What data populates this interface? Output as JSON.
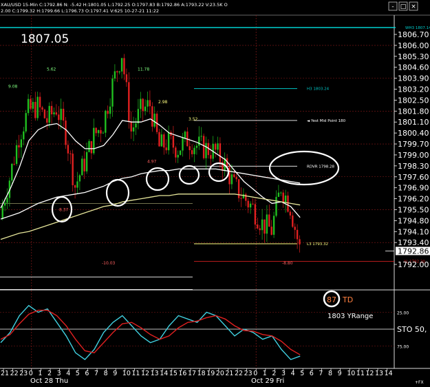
{
  "header": {
    "symbol_line": "XAU/USD  15-Min  C:1792.86  N: -5.42  H:1801.05  L:1792.25  O:1797.83  B:1792.86  A:1793.22  V:23.5K  O",
    "sub_line": "2.00  C:1799.32  H:1799.66  L:1796.73  O:1797.41  V:625  10-27-21  11:22",
    "window_buttons": [
      "-",
      "□",
      "×"
    ]
  },
  "big_price": "1807.05",
  "price_axis": {
    "ticks": [
      "1806.70",
      "1806.00",
      "1805.30",
      "1804.60",
      "1803.90",
      "1803.20",
      "1802.50",
      "1801.80",
      "1801.10",
      "1800.40",
      "1799.70",
      "1799.00",
      "1798.30",
      "1797.60",
      "1796.90",
      "1796.20",
      "1795.50",
      "1794.80",
      "1794.10",
      "1793.40",
      "1792.00"
    ],
    "tick_values": [
      1806.7,
      1806.0,
      1805.3,
      1804.6,
      1803.9,
      1803.2,
      1802.5,
      1801.8,
      1801.1,
      1800.4,
      1799.7,
      1799.0,
      1798.3,
      1797.6,
      1796.9,
      1796.2,
      1795.5,
      1794.8,
      1794.1,
      1793.4,
      1792.0
    ],
    "current_price": "1792.86",
    "current_value": 1792.86
  },
  "levels": [
    {
      "label": "WH3 1807.14",
      "value": 1807.14,
      "color": "#00d0d0"
    },
    {
      "label": "H3 1803.24",
      "value": 1803.24,
      "color": "#00c8c8"
    },
    {
      "label": "◄ Yest Mid Point 180",
      "value": 1801.2,
      "color": "#ffffff"
    },
    {
      "label": "RDVR 1798.28",
      "value": 1798.28,
      "color": "#ffffff"
    },
    {
      "label": "L3 1793.32",
      "value": 1793.32,
      "color": "#ffff80"
    },
    {
      "label": "YL 1792.20",
      "value": 1792.2,
      "color": "#d02020"
    }
  ],
  "annotations": [
    {
      "text": "9.08",
      "value": 1803.3,
      "color": "#80ff80"
    },
    {
      "text": "5.62",
      "value": 1804.4,
      "color": "#80ff80"
    },
    {
      "text": "11.78",
      "value": 1804.4,
      "color": "#80ff80"
    },
    {
      "text": "2.98",
      "value": 1802.3,
      "color": "#ffff80"
    },
    {
      "text": "3.52",
      "value": 1801.2,
      "color": "#ffff80"
    },
    {
      "text": "8.37",
      "value": 1795.4,
      "color": "#ff6060"
    },
    {
      "text": "4.97",
      "value": 1798.5,
      "color": "#ff6060"
    },
    {
      "text": "-10.03",
      "value": 1792.0,
      "color": "#ff6060"
    },
    {
      "text": "-8.80",
      "value": 1792.0,
      "color": "#ff6060"
    }
  ],
  "oscillator": {
    "name": "STO",
    "label": "STO  50,",
    "ticks": [
      "25.00",
      "75.00"
    ],
    "tick_values": [
      25,
      75
    ],
    "td_label": "87 TD",
    "td_number": "87",
    "yrange_label": "1803 YRange"
  },
  "time_axis": {
    "labels": [
      "21",
      "22",
      "23",
      "0",
      "1",
      "2",
      "3",
      "4",
      "5",
      "6",
      "7",
      "8",
      "9",
      "10",
      "11",
      "12",
      "13",
      "14",
      "15",
      "16",
      "17",
      "18",
      "19",
      "20",
      "21",
      "22",
      "23",
      "0",
      "1",
      "2",
      "3",
      "4",
      "5",
      "6",
      "7",
      "8",
      "9",
      "10",
      "11",
      "12",
      "13",
      "14"
    ],
    "day_labels": [
      "Oct 28 Thu",
      "Oct 29 Fri"
    ],
    "corner": "+FX"
  },
  "chart_data": {
    "type": "candlestick",
    "title": "XAU/USD 15-Min",
    "ylim": [
      1791.4,
      1807.6
    ],
    "x_hours": [
      "21",
      "22",
      "23",
      "0",
      "1",
      "2",
      "3",
      "4",
      "5",
      "6",
      "7",
      "8",
      "9",
      "10",
      "11",
      "12",
      "13",
      "14",
      "15",
      "16",
      "17",
      "18",
      "19",
      "20",
      "21",
      "22",
      "23",
      "0",
      "1",
      "2",
      "3",
      "4",
      "5"
    ],
    "close": [
      1795.2,
      1797.5,
      1800.2,
      1801.8,
      1802.1,
      1801.2,
      1802.0,
      1800.4,
      1797.0,
      1798.5,
      1800.2,
      1801.0,
      1803.5,
      1805.5,
      1800.5,
      1801.8,
      1802.2,
      1799.5,
      1799.8,
      1799.4,
      1800.0,
      1799.6,
      1799.4,
      1799.2,
      1798.4,
      1797.0,
      1796.3,
      1795.6,
      1794.6,
      1794.2,
      1797.0,
      1795.7,
      1793.0
    ],
    "series": [
      {
        "name": "white_ma",
        "color": "#ffffff",
        "values": [
          1795.6,
          1796.8,
          1798.2,
          1799.9,
          1800.6,
          1800.9,
          1801.0,
          1800.6,
          1799.9,
          1799.4,
          1799.4,
          1799.6,
          1800.3,
          1801.2,
          1801.1,
          1801.1,
          1801.3,
          1800.9,
          1800.4,
          1800.2,
          1800.0,
          1799.8,
          1799.5,
          1799.1,
          1798.7,
          1798.0,
          1797.3,
          1796.8,
          1796.3,
          1795.9,
          1796.0,
          1795.7,
          1795.0
        ]
      },
      {
        "name": "white_ma_long",
        "color": "#ffffff",
        "values": [
          1794.9,
          1795.1,
          1795.3,
          1795.6,
          1795.9,
          1796.1,
          1796.3,
          1796.4,
          1796.5,
          1796.6,
          1796.8,
          1797.0,
          1797.3,
          1797.5,
          1797.6,
          1797.8,
          1797.9,
          1798.0,
          1798.0,
          1798.1,
          1798.1,
          1798.1,
          1798.1,
          1798.1,
          1798.0,
          1797.9,
          1797.8,
          1797.7,
          1797.6,
          1797.5,
          1797.4,
          1797.3,
          1797.2
        ]
      },
      {
        "name": "yellow_ma",
        "color": "#e6e69a",
        "values": [
          1793.6,
          1793.8,
          1794.0,
          1794.1,
          1794.3,
          1794.5,
          1794.7,
          1794.9,
          1795.1,
          1795.3,
          1795.5,
          1795.7,
          1795.8,
          1796.0,
          1796.1,
          1796.2,
          1796.3,
          1796.4,
          1796.4,
          1796.5,
          1796.5,
          1796.5,
          1796.5,
          1796.5,
          1796.5,
          1796.5,
          1796.4,
          1796.3,
          1796.2,
          1796.1,
          1796.0,
          1795.9,
          1795.8
        ]
      }
    ],
    "oscillator_series": [
      {
        "name": "STO %K",
        "color": "#40d0e0",
        "values": [
          70,
          55,
          30,
          15,
          25,
          20,
          40,
          60,
          85,
          95,
          80,
          55,
          40,
          30,
          45,
          60,
          70,
          65,
          45,
          30,
          35,
          40,
          25,
          30,
          45,
          60,
          50,
          55,
          65,
          60,
          80,
          95,
          90
        ]
      },
      {
        "name": "STO %D",
        "color": "#e02020",
        "values": [
          65,
          58,
          42,
          28,
          22,
          22,
          30,
          45,
          65,
          82,
          85,
          70,
          55,
          42,
          40,
          48,
          58,
          65,
          60,
          48,
          40,
          38,
          33,
          30,
          35,
          45,
          52,
          53,
          58,
          60,
          68,
          80,
          88
        ]
      }
    ]
  }
}
